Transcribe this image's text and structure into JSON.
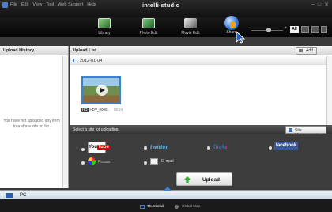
{
  "titlebar": {
    "menu": [
      "File",
      "Edit",
      "View",
      "Tool",
      "Web Support",
      "Help"
    ],
    "brand": "intelli-studio",
    "controls": [
      "–",
      "□",
      "✕"
    ]
  },
  "tabs": [
    {
      "label": "Library",
      "icon": "library-icon"
    },
    {
      "label": "Photo Edit",
      "icon": "photo-edit-icon"
    },
    {
      "label": "Movie Edit",
      "icon": "movie-edit-icon"
    },
    {
      "label": "Share",
      "icon": "share-globe-icon",
      "active": true
    }
  ],
  "view_controls": {
    "zoom_minus": "−",
    "zoom_plus": "+",
    "all_label": "All"
  },
  "left_panel": {
    "header": "Upload History",
    "empty_message": "You have not uploaded any item to a share site so far."
  },
  "main_panel": {
    "header": "Upload List",
    "add_label": "Add",
    "date": "2012-01-04",
    "item": {
      "badge": "HD",
      "filename": "HDV_0005..",
      "duration": "00:24"
    }
  },
  "upload": {
    "prompt": "Select a site for uploading.",
    "site_management_label": "Site Management",
    "sites": {
      "youtube_you": "You",
      "youtube_tube": "Tube",
      "youtube_ready": "READY",
      "twitter": "twitter",
      "flickr_main": "flick",
      "flickr_r": "r",
      "facebook": "facebook",
      "picasa": "Picasa",
      "email": "E-mail"
    },
    "upload_label": "Upload"
  },
  "bottom": {
    "pc_label": "PC",
    "thumbnail_label": "Thumbnail",
    "global_map_label": "Global Map"
  },
  "colors": {
    "accent": "#3b82d6",
    "facebook": "#3b5998",
    "twitter": "#5fb8ea"
  }
}
